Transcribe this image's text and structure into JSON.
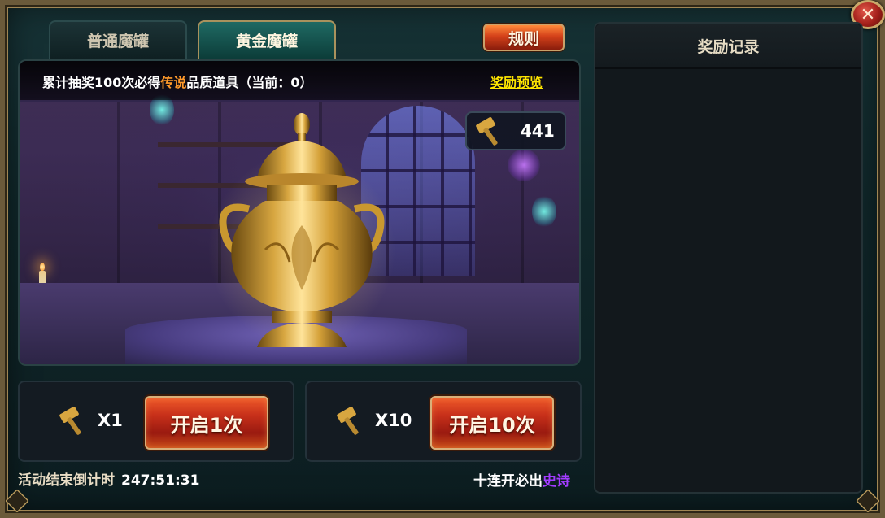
{
  "tabs": [
    {
      "label": "普通魔罐",
      "active": false
    },
    {
      "label": "黄金魔罐",
      "active": true
    }
  ],
  "rules_button": "规则",
  "close_icon": "close-icon",
  "progress": {
    "prefix": "累计抽奖100次必得",
    "legend_word": "传说",
    "suffix": "品质道具（当前：0）"
  },
  "preview_link": "奖励预览",
  "hammer_count": "441",
  "draw_options": [
    {
      "cost": "X1",
      "button": "开启1次"
    },
    {
      "cost": "X10",
      "button": "开启10次"
    }
  ],
  "countdown": {
    "label": "活动结束倒计时",
    "time": "247:51:31"
  },
  "guarantee": {
    "prefix": "十连开必出",
    "epic_word": "史诗"
  },
  "records": {
    "title": "奖励记录",
    "items": []
  },
  "colors": {
    "legend": "#ff9a2a",
    "epic": "#a23cff",
    "link": "#ffe600",
    "button_red": "#c7301a",
    "gold_tab": "#1f6a63"
  }
}
